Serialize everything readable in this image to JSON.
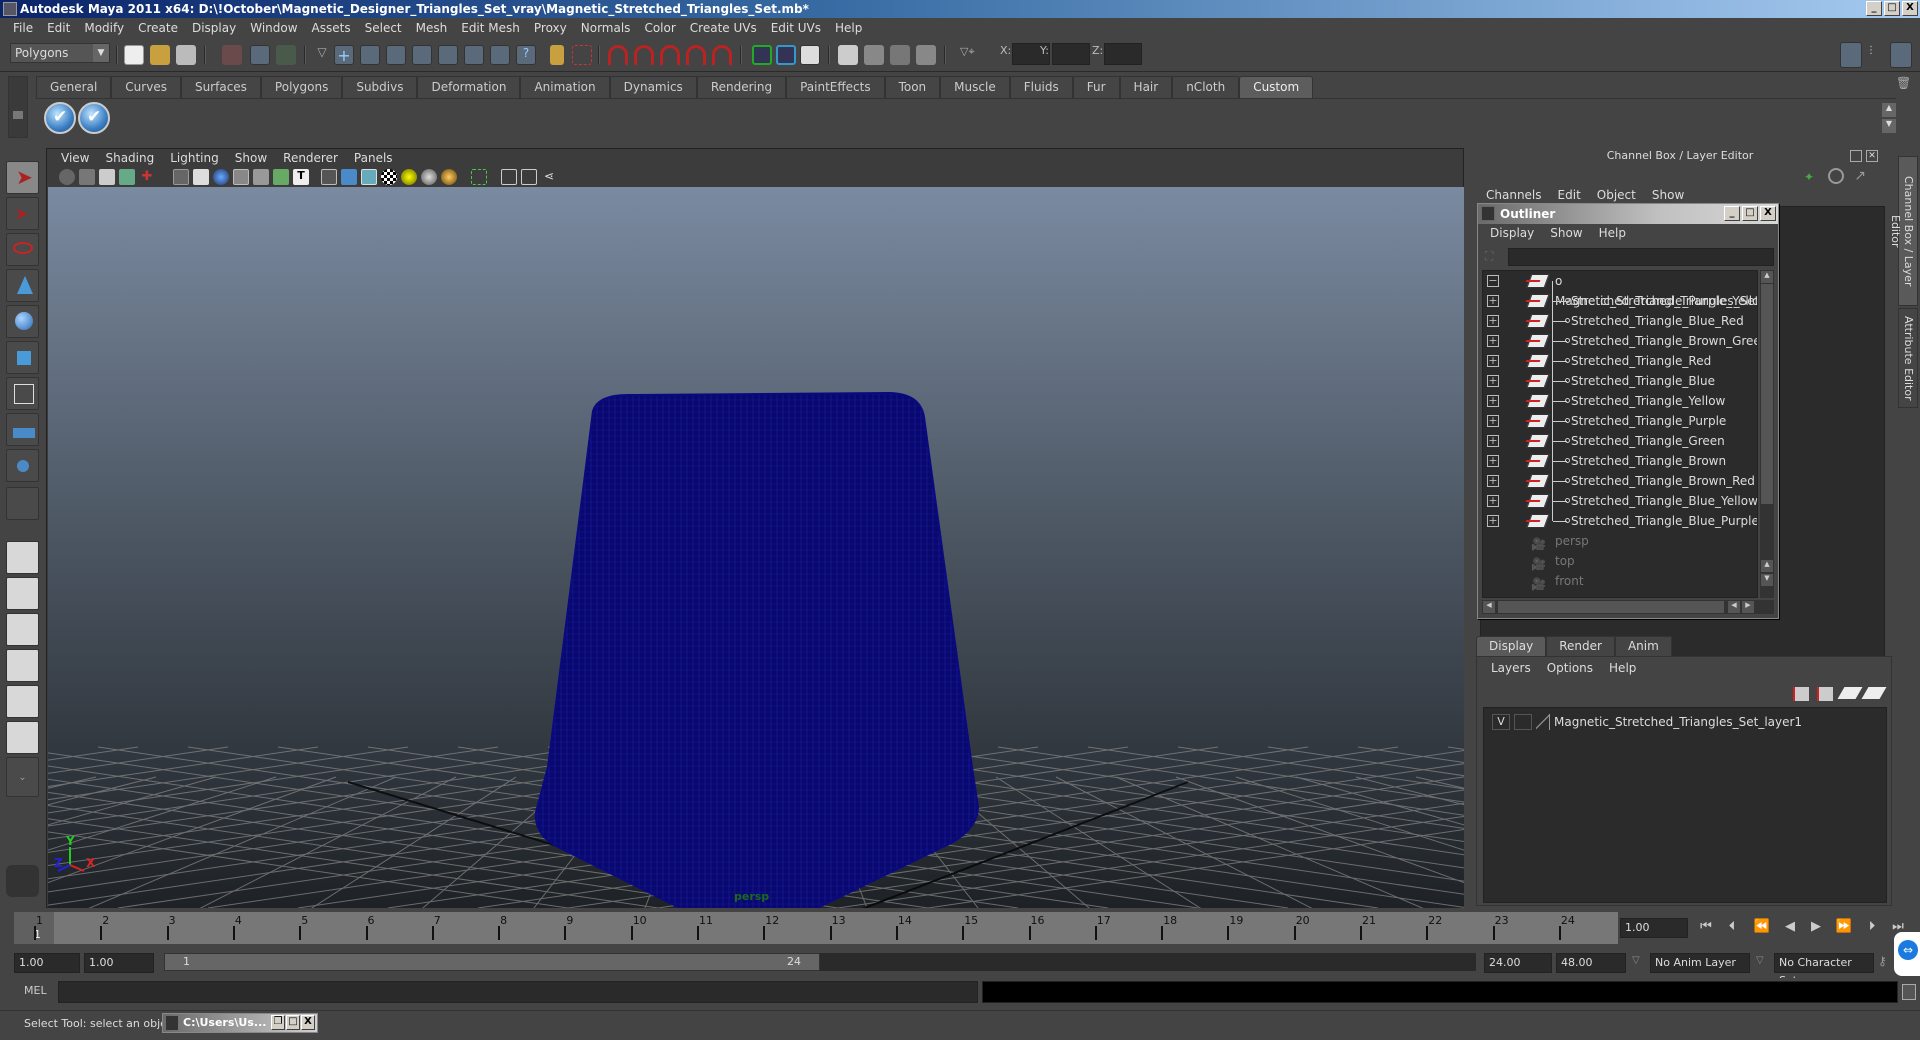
{
  "window": {
    "title": "Autodesk Maya 2011 x64: D:\\!October\\Magnetic_Designer_Triangles_Set_vray\\Magnetic_Stretched_Triangles_Set.mb*",
    "minimize": "_",
    "maximize": "□",
    "close": "X"
  },
  "menubar": [
    "File",
    "Edit",
    "Modify",
    "Create",
    "Display",
    "Window",
    "Assets",
    "Select",
    "Mesh",
    "Edit Mesh",
    "Proxy",
    "Normals",
    "Color",
    "Create UVs",
    "Edit UVs",
    "Help"
  ],
  "statusline": {
    "mode": "Polygons",
    "x_label": "X:",
    "y_label": "Y:",
    "z_label": "Z:",
    "x_value": "",
    "y_value": "",
    "z_value": ""
  },
  "shelf": {
    "tabs": [
      "General",
      "Curves",
      "Surfaces",
      "Polygons",
      "Subdivs",
      "Deformation",
      "Animation",
      "Dynamics",
      "Rendering",
      "PaintEffects",
      "Toon",
      "Muscle",
      "Fluids",
      "Fur",
      "Hair",
      "nCloth",
      "Custom"
    ],
    "active_tab": "Custom",
    "buttons": [
      "check-shelf-button-1",
      "check-shelf-button-2"
    ]
  },
  "viewport": {
    "menu": [
      "View",
      "Shading",
      "Lighting",
      "Show",
      "Renderer",
      "Panels"
    ],
    "camera_label": "persp",
    "axis": {
      "x": "X",
      "y": "Y",
      "z": "Z"
    },
    "wireframe_color": "#0a0a78",
    "bg_top": "#7a8aa0",
    "bg_bottom": "#1e2226"
  },
  "channel_box": {
    "title": "Channel Box / Layer Editor",
    "menu": [
      "Channels",
      "Edit",
      "Object",
      "Show"
    ]
  },
  "outliner": {
    "title": "Outliner",
    "menu": [
      "Display",
      "Show",
      "Help"
    ],
    "filter_value": "",
    "root": "Magnetic_Stretched_Triangles_Set",
    "children": [
      "Stretched_Triangle_Purple_Yellow",
      "Stretched_Triangle_Blue_Red",
      "Stretched_Triangle_Brown_Green",
      "Stretched_Triangle_Red",
      "Stretched_Triangle_Blue",
      "Stretched_Triangle_Yellow",
      "Stretched_Triangle_Purple",
      "Stretched_Triangle_Green",
      "Stretched_Triangle_Brown",
      "Stretched_Triangle_Brown_Red",
      "Stretched_Triangle_Blue_Yellow",
      "Stretched_Triangle_Blue_Purple"
    ],
    "cameras": [
      "persp",
      "top",
      "front"
    ]
  },
  "layer_editor": {
    "tabs": [
      "Display",
      "Render",
      "Anim"
    ],
    "active_tab": "Display",
    "menu": [
      "Layers",
      "Options",
      "Help"
    ],
    "layers": [
      {
        "visible": "V",
        "name": "Magnetic_Stretched_Triangles_Set_layer1"
      }
    ]
  },
  "side_tabs": [
    "Channel Box / Layer Editor",
    "Attribute Editor"
  ],
  "timeline": {
    "ticks": [
      "1",
      "2",
      "3",
      "4",
      "5",
      "6",
      "7",
      "8",
      "9",
      "10",
      "11",
      "12",
      "13",
      "14",
      "15",
      "16",
      "17",
      "18",
      "19",
      "20",
      "21",
      "22",
      "23",
      "24"
    ],
    "current_frame_marker": "1",
    "current_frame": "1.00"
  },
  "range": {
    "start": "1.00",
    "playback_start": "1.00",
    "slider_start": "1",
    "slider_end": "24",
    "playback_end": "24.00",
    "end": "48.00",
    "anim_layer": "No Anim Layer",
    "character_set": "No Character Set"
  },
  "command_line": {
    "label": "MEL",
    "value": "",
    "result": ""
  },
  "help_line": {
    "text": "Select Tool: select an object",
    "minimized_window": "C:\\Users\\Us..."
  }
}
